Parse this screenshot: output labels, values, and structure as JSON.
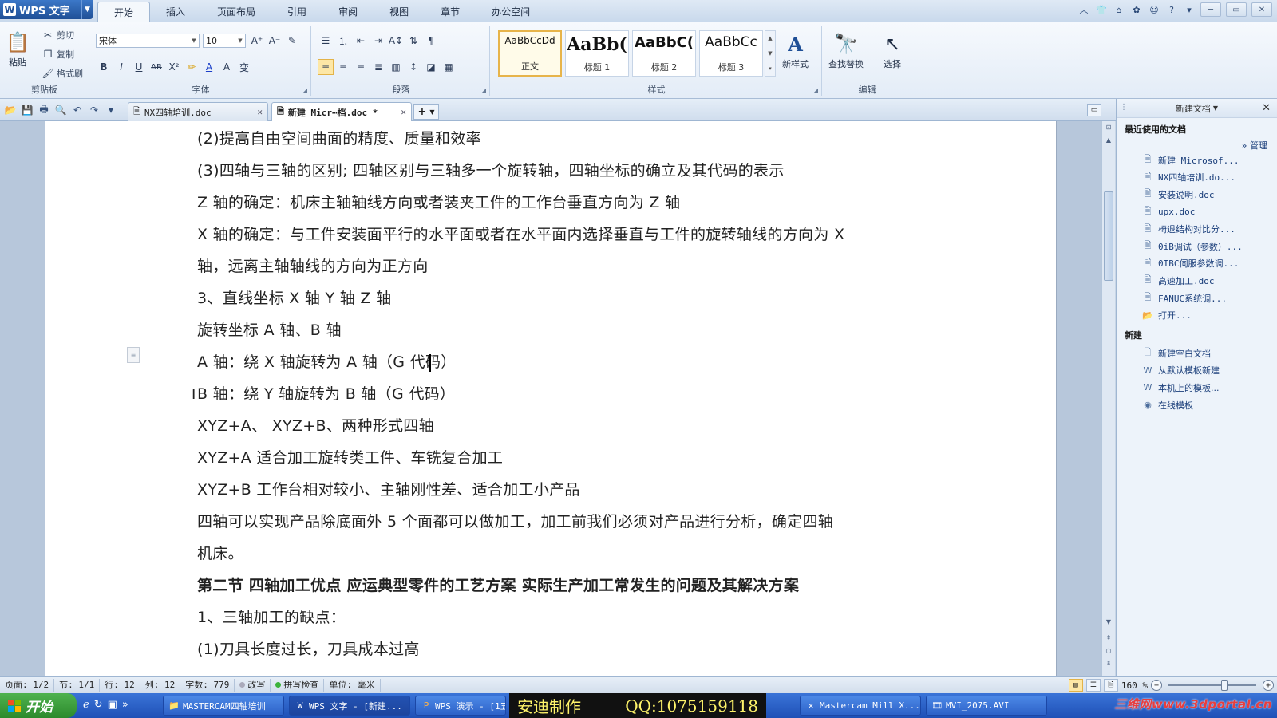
{
  "app": {
    "name": "WPS 文字"
  },
  "ribbon_tabs": [
    "开始",
    "插入",
    "页面布局",
    "引用",
    "审阅",
    "视图",
    "章节",
    "办公空间"
  ],
  "ribbon": {
    "clipboard": {
      "label": "剪贴板",
      "paste": "粘贴",
      "cut": "剪切",
      "copy": "复制",
      "format_painter": "格式刷"
    },
    "font": {
      "label": "字体",
      "font_name": "宋体",
      "font_size": "10"
    },
    "paragraph": {
      "label": "段落"
    },
    "styles": {
      "label": "样式",
      "items": [
        {
          "preview": "AaBbCcDd",
          "name": "正文"
        },
        {
          "preview": "AaBb(",
          "name": "标题 1"
        },
        {
          "preview": "AaBbC(",
          "name": "标题 2"
        },
        {
          "preview": "AaBbCc",
          "name": "标题 3"
        }
      ],
      "new_style": "新样式"
    },
    "editing": {
      "label": "编辑",
      "find_replace": "查找替换",
      "select": "选择"
    }
  },
  "doc_tabs": [
    {
      "label": "NX四轴培训.doc",
      "active": false
    },
    {
      "label": "新建 Micr⋯档.doc *",
      "active": true
    }
  ],
  "document": {
    "lines": [
      {
        "text": "(2)提高自由空间曲面的精度、质量和效率",
        "bold": false
      },
      {
        "text": "(3)四轴与三轴的区别; 四轴区别与三轴多一个旋转轴，四轴坐标的确立及其代码的表示",
        "bold": false
      },
      {
        "text": "Z 轴的确定：机床主轴轴线方向或者装夹工件的工作台垂直方向为 Z 轴",
        "bold": false
      },
      {
        "text": "X 轴的确定：与工件安装面平行的水平面或者在水平面内选择垂直与工件的旋转轴线的方向为 X",
        "bold": false
      },
      {
        "text": "轴，远离主轴轴线的方向为正方向",
        "bold": false
      },
      {
        "text": "3、直线坐标 X 轴 Y 轴 Z 轴",
        "bold": false
      },
      {
        "text": "旋转坐标 A 轴、B 轴",
        "bold": false
      },
      {
        "text": "A 轴：绕 X 轴旋转为 A 轴（G 代码）",
        "bold": false
      },
      {
        "text": "B 轴：绕 Y 轴旋转为 B 轴（G 代码）",
        "bold": false
      },
      {
        "text": "XYZ+A、 XYZ+B、两种形式四轴",
        "bold": false
      },
      {
        "text": "XYZ+A 适合加工旋转类工件、车铣复合加工",
        "bold": false
      },
      {
        "text": "XYZ+B 工作台相对较小、主轴刚性差、适合加工小产品",
        "bold": false
      },
      {
        "text": "四轴可以实现产品除底面外 5 个面都可以做加工，加工前我们必须对产品进行分析，确定四轴",
        "bold": false
      },
      {
        "text": "机床。",
        "bold": false
      },
      {
        "text": "第二节 四轴加工优点 应运典型零件的工艺方案 实际生产加工常发生的问题及其解决方案",
        "bold": true
      },
      {
        "text": "1、三轴加工的缺点：",
        "bold": false
      },
      {
        "text": "(1)刀具长度过长，刀具成本过高",
        "bold": false
      }
    ]
  },
  "task_pane": {
    "title": "新建文档",
    "recent_label": "最近使用的文档",
    "manage_label": "管理",
    "recent_docs": [
      "新建 Microsof...",
      "NX四轴培训.do...",
      "安装说明.doc",
      "upx.doc",
      "椅退结构对比分...",
      "0iB调试（参数）...",
      "0IBC伺服参数调...",
      "高速加工.doc",
      "FANUC系统调...",
      "打开..."
    ],
    "new_label": "新建",
    "new_items": [
      "新建空白文档",
      "从默认模板新建",
      "本机上的模板...",
      "在线模板"
    ]
  },
  "status_bar": {
    "page": "页面: 1/2",
    "section": "节: 1/1",
    "row": "行: 12",
    "col": "列: 12",
    "words": "字数: 779",
    "overwrite": "改写",
    "spellcheck": "拼写检查",
    "unit": "单位: 毫米",
    "zoom": "160 %"
  },
  "taskbar": {
    "start": "开始",
    "tasks": [
      {
        "label": "MASTERCAM四轴培训",
        "icon": "folder-icon"
      },
      {
        "label": "WPS 文字 - [新建...",
        "icon": "wps-writer-icon"
      },
      {
        "label": "WPS 演示 - [1五",
        "icon": "wps-presentation-icon"
      },
      {
        "label": "Mastercam Mill X...",
        "icon": "mastercam-icon"
      },
      {
        "label": "MVI_2075.AVI",
        "icon": "video-icon"
      }
    ],
    "banner_left": "安迪制作",
    "banner_right": "QQ:1075159118",
    "watermark": "三维网www.3dportal.cn"
  }
}
